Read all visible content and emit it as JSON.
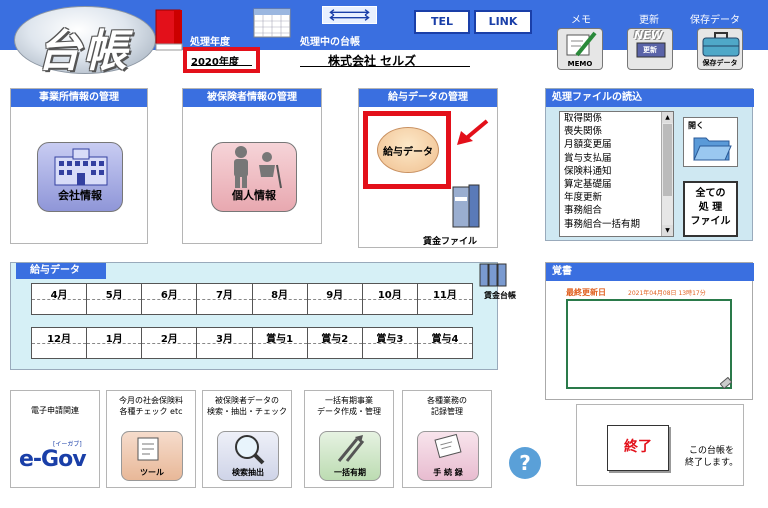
{
  "app": {
    "logo_text": "台帳"
  },
  "header": {
    "year_label": "処理年度",
    "current_label": "処理中の台帳",
    "year_value": "2020年度",
    "company_name": "株式会社 セルズ",
    "tel_label": "TEL",
    "link_label": "LINK",
    "memo_label": "メモ",
    "memo_caption": "MEMO",
    "update_label": "更新",
    "update_new": "NEW",
    "update_caption": "更新",
    "save_label": "保存データ",
    "save_caption": "保存データ"
  },
  "panels": {
    "office": {
      "title": "事業所情報の管理",
      "tile_label": "会社情報"
    },
    "insured": {
      "title": "被保険者情報の管理",
      "tile_label": "個人情報"
    },
    "salary": {
      "title": "給与データの管理",
      "tile_label": "給与データ",
      "file_label": "賃金ファイル"
    }
  },
  "file_panel": {
    "title": "処理ファイルの読込",
    "items": [
      "取得関係",
      "喪失関係",
      "月額変更届",
      "賞与支払届",
      "保険料通知",
      "算定基礎届",
      "年度更新",
      "事務組合",
      "事務組合一括有期"
    ],
    "open_label": "開く",
    "all_files_line1": "全ての",
    "all_files_line2": "処 理",
    "all_files_line3": "ファイル"
  },
  "salary_data": {
    "title": "給与データ",
    "row1": [
      "4月",
      "5月",
      "6月",
      "7月",
      "8月",
      "9月",
      "10月",
      "11月"
    ],
    "row2": [
      "12月",
      "1月",
      "2月",
      "3月",
      "賞与1",
      "賞与2",
      "賞与3",
      "賞与4"
    ],
    "ledger_label": "賃金台帳"
  },
  "notes": {
    "title": "覚書",
    "last_updated_label": "最終更新日",
    "last_updated_value": "2021年04月08日 13時17分"
  },
  "bottom_tiles": [
    {
      "top1": "電子申請関連",
      "top2": "",
      "caption": "e-Gov",
      "sub": "[イーガブ]"
    },
    {
      "top1": "今月の社会保険料",
      "top2": "各種チェック etc",
      "caption": "ツール"
    },
    {
      "top1": "被保険者データの",
      "top2": "検索・抽出・チェック",
      "caption": "検索抽出"
    },
    {
      "top1": "一括有期事業",
      "top2": "データ作成・管理",
      "caption": "一括有期"
    },
    {
      "top1": "各種業務の",
      "top2": "記録管理",
      "caption": "手 続 録"
    }
  ],
  "help": {
    "label": "?"
  },
  "exit": {
    "button_label": "終了",
    "desc_line1": "この台帳を",
    "desc_line2": "終了します。"
  },
  "colors": {
    "header_blue": "#3a6fe0",
    "highlight_red": "#e3101a",
    "notes_green": "#2a7a4a"
  }
}
